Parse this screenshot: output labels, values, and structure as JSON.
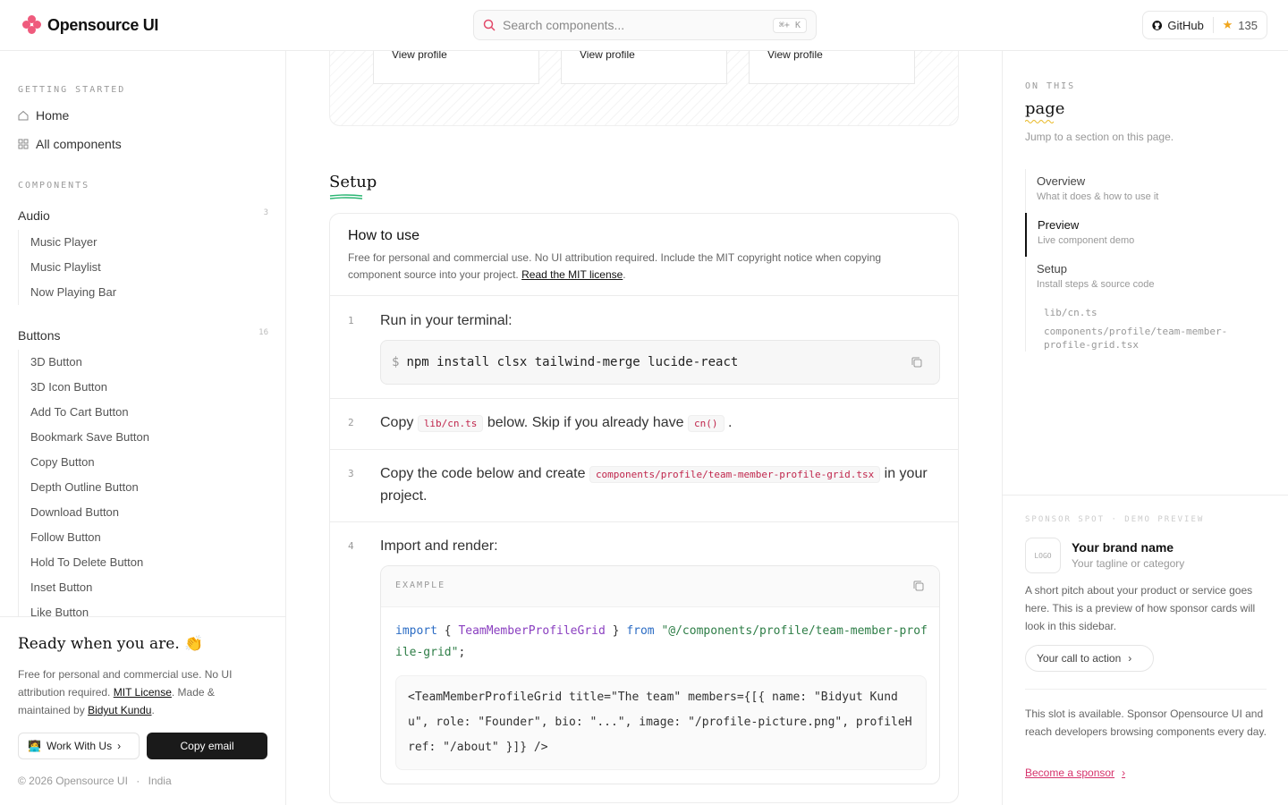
{
  "header": {
    "brand": "Opensource UI",
    "search_placeholder": "Search components...",
    "search_shortcut": "⌘+ K",
    "github_label": "GitHub",
    "stars": "135"
  },
  "sidebar": {
    "getting_started_label": "GETTING STARTED",
    "home": "Home",
    "all_components": "All components",
    "components_label": "COMPONENTS",
    "groups": [
      {
        "label": "Audio",
        "count": "3",
        "items": [
          "Music Player",
          "Music Playlist",
          "Now Playing Bar"
        ]
      },
      {
        "label": "Buttons",
        "count": "16",
        "items": [
          "3D Button",
          "3D Icon Button",
          "Add To Cart Button",
          "Bookmark Save Button",
          "Copy Button",
          "Depth Outline Button",
          "Download Button",
          "Follow Button",
          "Hold To Delete Button",
          "Inset Button",
          "Like Button"
        ]
      }
    ],
    "footer": {
      "title": "Ready when you are.",
      "text_1": "Free for personal and commercial use. No UI attribution required.",
      "mit_link": "MIT License",
      "text_2": ". Made & maintained by",
      "author_link": "Bidyut Kundu",
      "text_3": ".",
      "work_button": "Work With Us",
      "copy_button": "Copy email",
      "copyright": "© 2026 Opensource UI",
      "location": "India"
    }
  },
  "main": {
    "profile_cards": [
      "View profile",
      "View profile",
      "View profile"
    ],
    "setup_title": "Setup",
    "howto_title": "How to use",
    "howto_desc": "Free for personal and commercial use. No UI attribution required. Include the MIT copyright notice when copying component source into your project.",
    "howto_link": "Read the MIT license",
    "steps": {
      "s1_num": "1",
      "s1_text": "Run in your terminal:",
      "s1_cmd": "npm install clsx tailwind-merge lucide-react",
      "s2_num": "2",
      "s2_a": "Copy",
      "s2_code": "lib/cn.ts",
      "s2_b": "below. Skip if you already have",
      "s2_code2": "cn()",
      "s2_c": ".",
      "s3_num": "3",
      "s3_a": "Copy the code below and create",
      "s3_code": "components/profile/team-member-profile-grid.tsx",
      "s3_b": "in your project.",
      "s4_num": "4",
      "s4_text": "Import and render:"
    },
    "example": {
      "label": "EXAMPLE",
      "import_kw": "import",
      "import_name": "TeamMemberProfileGrid",
      "from_kw": "from",
      "import_path": "\"@/components/profile/team-member-profile-grid\"",
      "jsx": "<TeamMemberProfileGrid title=\"The team\" members={[{ name: \"Bidyut Kundu\", role: \"Founder\", bio: \"...\", image: \"/profile-picture.png\", profileHref: \"/about\" }]} />"
    }
  },
  "right": {
    "on_this": "ON THIS",
    "page": "page",
    "jump": "Jump to a section on this page.",
    "toc": [
      {
        "title": "Overview",
        "sub": "What it does & how to use it"
      },
      {
        "title": "Preview",
        "sub": "Live component demo"
      },
      {
        "title": "Setup",
        "sub": "Install steps & source code"
      }
    ],
    "toc_files": [
      "lib/cn.ts",
      "components/profile/team-member-profile-grid.tsx"
    ],
    "sponsor": {
      "label": "SPONSOR SPOT · DEMO PREVIEW",
      "logo": "LOGO",
      "brand_name": "Your brand name",
      "tagline": "Your tagline or category",
      "pitch": "A short pitch about your product or service goes here. This is a preview of how sponsor cards will look in this sidebar.",
      "cta": "Your call to action",
      "available": "This slot is available. Sponsor Opensource UI and reach developers browsing components every day.",
      "become": "Become a sponsor"
    }
  },
  "colors": {
    "accent": "#ef5b7d",
    "code_red": "#c0264c",
    "link_pink": "#d6336c"
  }
}
